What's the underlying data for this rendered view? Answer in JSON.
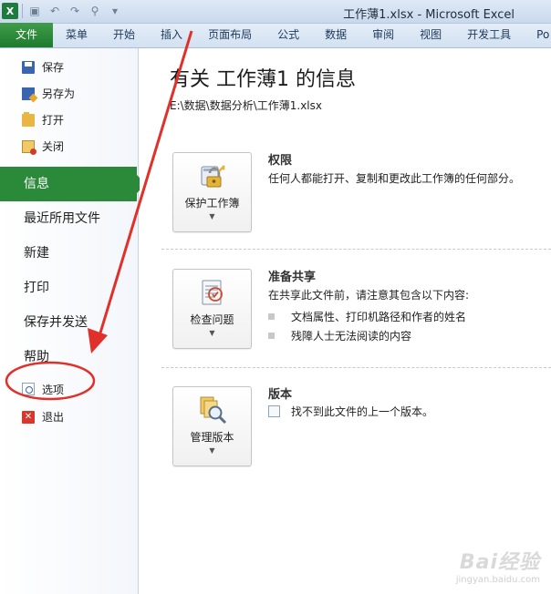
{
  "window": {
    "title": "工作薄1.xlsx - Microsoft Excel"
  },
  "quick_access": [
    "excel-logo",
    "save-icon",
    "undo-icon",
    "redo-icon",
    "find-icon"
  ],
  "ribbon_tabs": [
    "文件",
    "菜单",
    "开始",
    "插入",
    "页面布局",
    "公式",
    "数据",
    "审阅",
    "视图",
    "开发工具",
    "Po"
  ],
  "sidebar": {
    "small_items": [
      {
        "label": "保存",
        "icon": "save-icon"
      },
      {
        "label": "另存为",
        "icon": "save-as-icon"
      },
      {
        "label": "打开",
        "icon": "open-folder-icon"
      },
      {
        "label": "关闭",
        "icon": "close-file-icon"
      }
    ],
    "big_items": [
      {
        "label": "信息",
        "active": true
      },
      {
        "label": "最近所用文件"
      },
      {
        "label": "新建"
      },
      {
        "label": "打印"
      },
      {
        "label": "保存并发送"
      },
      {
        "label": "帮助"
      }
    ],
    "bottom_items": [
      {
        "label": "选项",
        "icon": "options-icon"
      },
      {
        "label": "退出",
        "icon": "exit-icon"
      }
    ]
  },
  "main": {
    "title": "有关 工作薄1 的信息",
    "path": "E:\\数据\\数据分析\\工作薄1.xlsx",
    "sections": [
      {
        "button_label": "保护工作簿",
        "icon": "lock-key-icon",
        "title": "权限",
        "description": "任何人都能打开、复制和更改此工作簿的任何部分。"
      },
      {
        "button_label": "检查问题",
        "icon": "checklist-icon",
        "title": "准备共享",
        "description": "在共享此文件前，请注意其包含以下内容:",
        "bullets": [
          "文档属性、打印机路径和作者的姓名",
          "残障人士无法阅读的内容"
        ]
      },
      {
        "button_label": "管理版本",
        "icon": "version-magnifier-icon",
        "title": "版本",
        "version_note": "找不到此文件的上一个版本。"
      }
    ]
  },
  "colors": {
    "file_tab": "#2b8a3a",
    "annotation": "#e0302a"
  },
  "watermark": {
    "brand": "Bai经验",
    "url": "jingyan.baidu.com"
  }
}
